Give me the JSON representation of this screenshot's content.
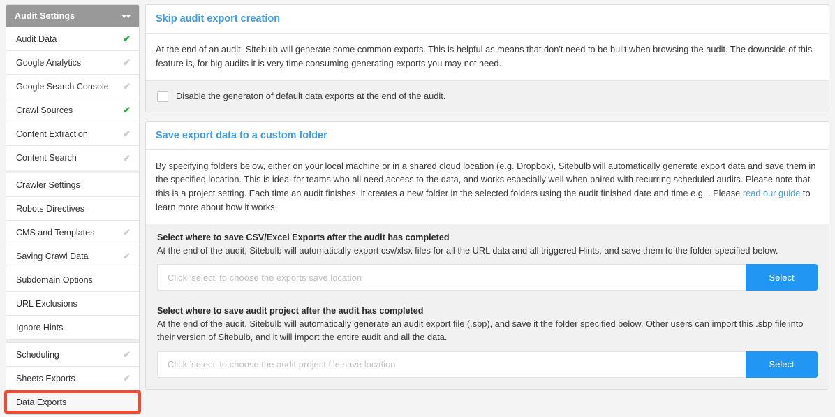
{
  "sidebar": {
    "header": {
      "title": "Audit Settings",
      "chevron_icon": "double-chevron-down-icon"
    },
    "groups": [
      {
        "items": [
          {
            "label": "Audit Data",
            "check": "check-icon",
            "state": "on"
          },
          {
            "label": "Google Analytics",
            "check": "check-icon",
            "state": "off"
          },
          {
            "label": "Google Search Console",
            "check": "check-icon",
            "state": "off"
          },
          {
            "label": "Crawl Sources",
            "check": "check-icon",
            "state": "on"
          },
          {
            "label": "Content Extraction",
            "check": "check-icon",
            "state": "off"
          },
          {
            "label": "Content Search",
            "check": "check-icon",
            "state": "off"
          }
        ]
      },
      {
        "items": [
          {
            "label": "Crawler Settings",
            "check": null,
            "state": "none"
          },
          {
            "label": "Robots Directives",
            "check": null,
            "state": "none"
          },
          {
            "label": "CMS and Templates",
            "check": "check-icon",
            "state": "off"
          },
          {
            "label": "Saving Crawl Data",
            "check": "check-icon",
            "state": "off"
          },
          {
            "label": "Subdomain Options",
            "check": null,
            "state": "none"
          },
          {
            "label": "URL Exclusions",
            "check": null,
            "state": "none"
          },
          {
            "label": "Ignore Hints",
            "check": null,
            "state": "none"
          }
        ]
      },
      {
        "items": [
          {
            "label": "Scheduling",
            "check": "check-icon",
            "state": "off"
          },
          {
            "label": "Sheets Exports",
            "check": "check-icon",
            "state": "off"
          },
          {
            "label": "Data Exports",
            "check": null,
            "state": "none",
            "active": true
          }
        ]
      }
    ],
    "annotation_color": "#ef4a34"
  },
  "panels": {
    "skip_export": {
      "title": "Skip audit export creation",
      "body": "At the end of an audit, Sitebulb will generate some common exports. This is helpful as means that don't need to be built when browsing the audit. The downside of this feature is, for big audits it is very time consuming generating exports you may not need.",
      "checkbox_label": "Disable the generaton of default data exports at the end of the audit.",
      "checkbox_checked": false
    },
    "custom_folder": {
      "title": "Save export data to a custom folder",
      "body_part1": "By specifying folders below, either on your local machine or in a shared cloud location (e.g. Dropbox), Sitebulb will automatically generate export data and save them in the specified location. This is ideal for teams who all need access to the data, and works especially well when paired with recurring scheduled audits. Please note that this is a project setting. Each time an audit finishes, it creates a new folder in the selected folders using the audit finished date and time e.g. . Please ",
      "body_link": "read our guide",
      "body_part2": " to learn more about how it works.",
      "fields": [
        {
          "label": "Select where to save CSV/Excel Exports after the audit has completed",
          "desc": "At the end of the audit, Sitebulb will automatically export csv/xlsx files for all the URL data and all triggered Hints, and save them to the folder specified below.",
          "placeholder": "Click 'select' to choose the exports save location",
          "value": "",
          "button": "Select"
        },
        {
          "label": "Select where to save audit project after the audit has completed",
          "desc": "At the end of the audit, Sitebulb will automatically generate an audit export file (.sbp), and save it the folder specified below. Other users can import this .sbp file into their version of Sitebulb, and it will import the entire audit and all the data.",
          "placeholder": "Click 'select' to choose the audit project file save location",
          "value": "",
          "button": "Select"
        }
      ]
    }
  },
  "colors": {
    "accent_blue": "#2196f3",
    "title_blue": "#3c9bea",
    "check_on": "#2faa4a",
    "check_off": "#cccccc",
    "annotation_red": "#ef4a34",
    "sidebar_header_bg": "#999999"
  }
}
